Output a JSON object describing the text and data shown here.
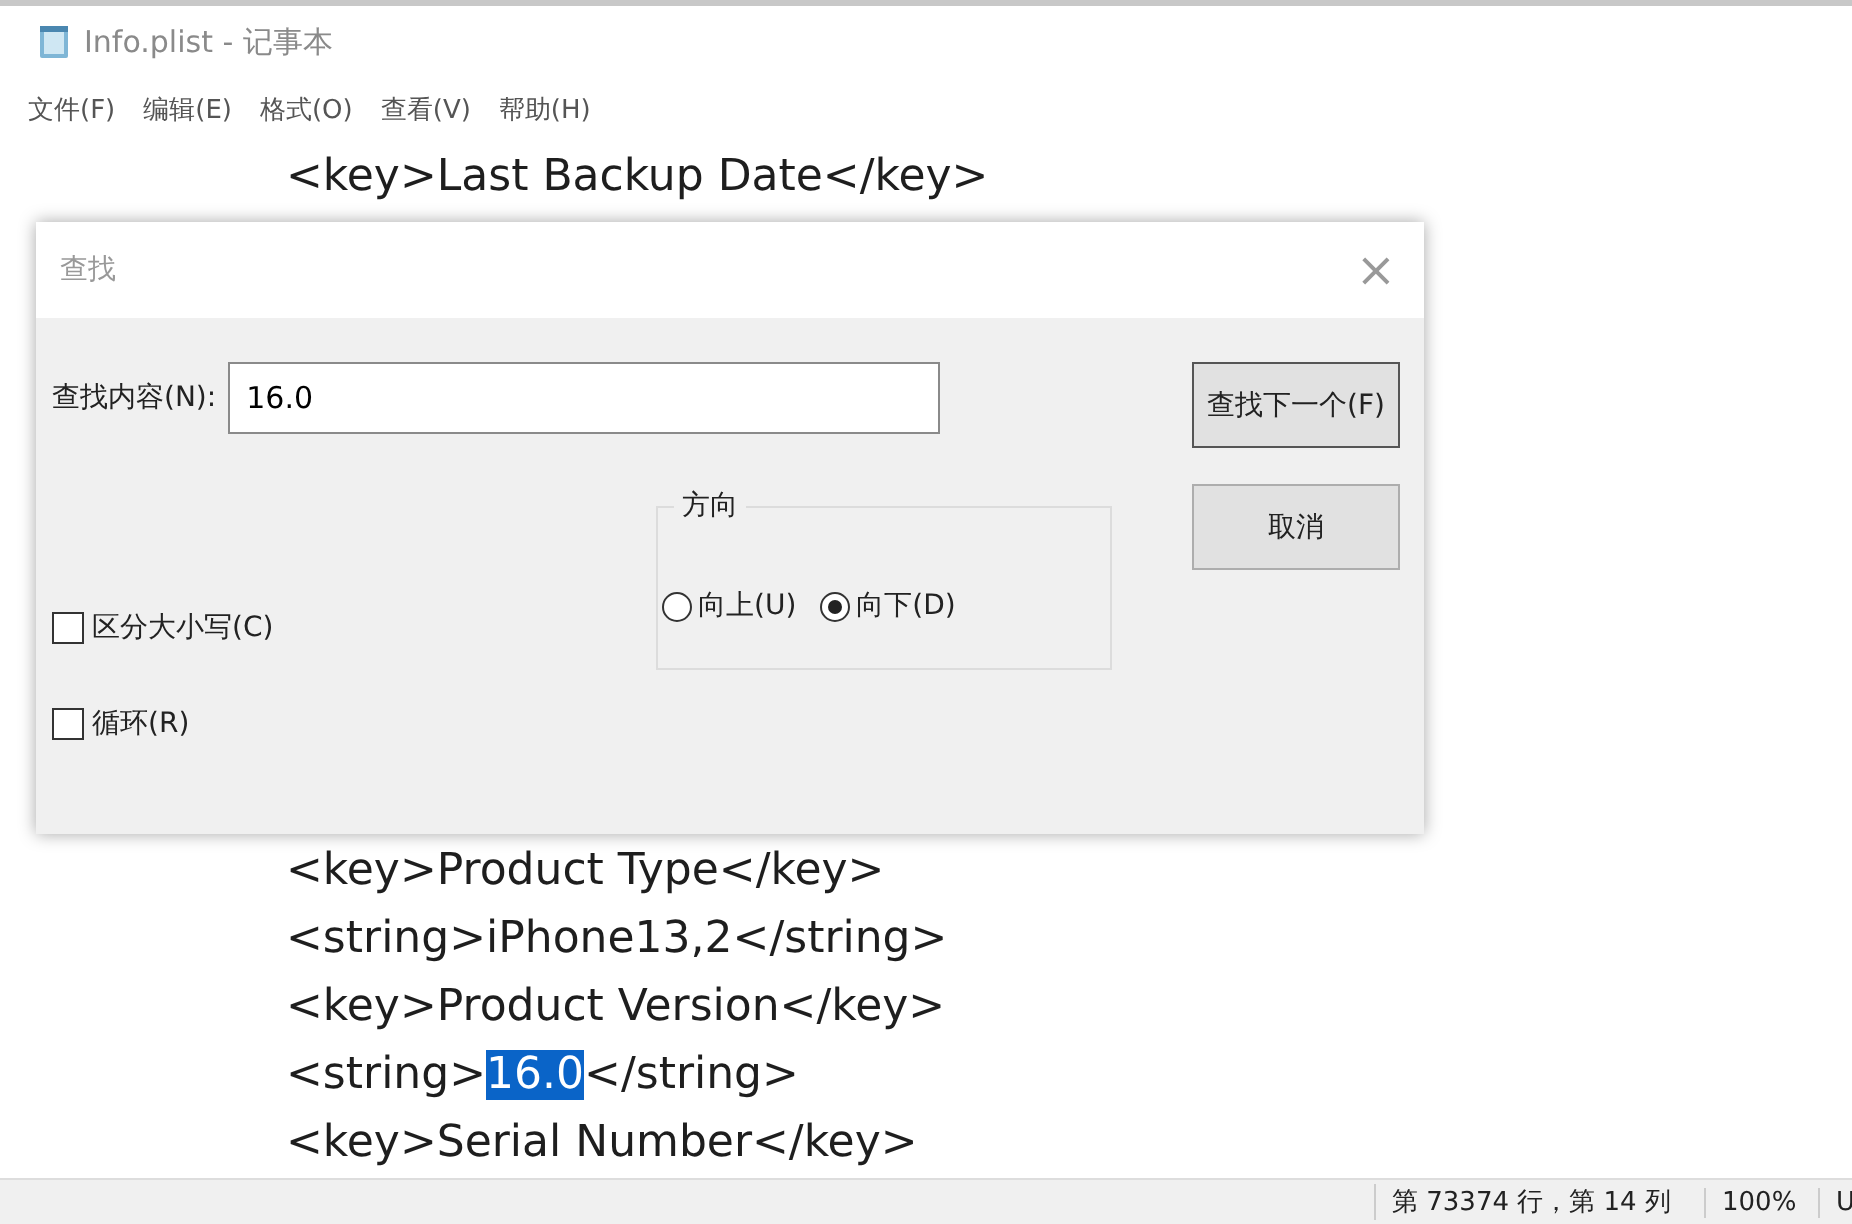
{
  "window": {
    "title": "Info.plist - 记事本"
  },
  "menu": [
    "文件(F)",
    "编辑(E)",
    "格式(O)",
    "查看(V)",
    "帮助(H)"
  ],
  "editor": {
    "lines_above": [
      {
        "segments": [
          {
            "text": "<key>Last Backup Date</key>",
            "selected": false
          }
        ]
      }
    ],
    "lines_below": [
      {
        "segments": [
          {
            "text": "<key>Product Type</key>",
            "selected": false
          }
        ]
      },
      {
        "segments": [
          {
            "text": "<string>iPhone13,2</string>",
            "selected": false
          }
        ]
      },
      {
        "segments": [
          {
            "text": "<key>Product Version</key>",
            "selected": false
          }
        ]
      },
      {
        "segments": [
          {
            "text": "<string>",
            "selected": false
          },
          {
            "text": "16.0",
            "selected": true
          },
          {
            "text": "</string>",
            "selected": false
          }
        ]
      },
      {
        "segments": [
          {
            "text": "<key>Serial Number</key>",
            "selected": false
          }
        ]
      }
    ]
  },
  "find_dialog": {
    "title": "查找",
    "close": "×",
    "find_label": "查找内容(N):",
    "find_value": "16.0",
    "buttons": [
      {
        "label": "查找下一个(F)",
        "default": true
      },
      {
        "label": "取消",
        "default": false
      }
    ],
    "direction": {
      "label": "方向",
      "options": [
        {
          "label": "向上(U)",
          "selected": false
        },
        {
          "label": "向下(D)",
          "selected": true
        }
      ]
    },
    "checkboxes": [
      {
        "label": "区分大小写(C)",
        "checked": false
      },
      {
        "label": "循环(R)",
        "checked": false
      }
    ]
  },
  "status_bar": [
    "第 73374 行，第 14 列",
    "100%",
    "U"
  ]
}
